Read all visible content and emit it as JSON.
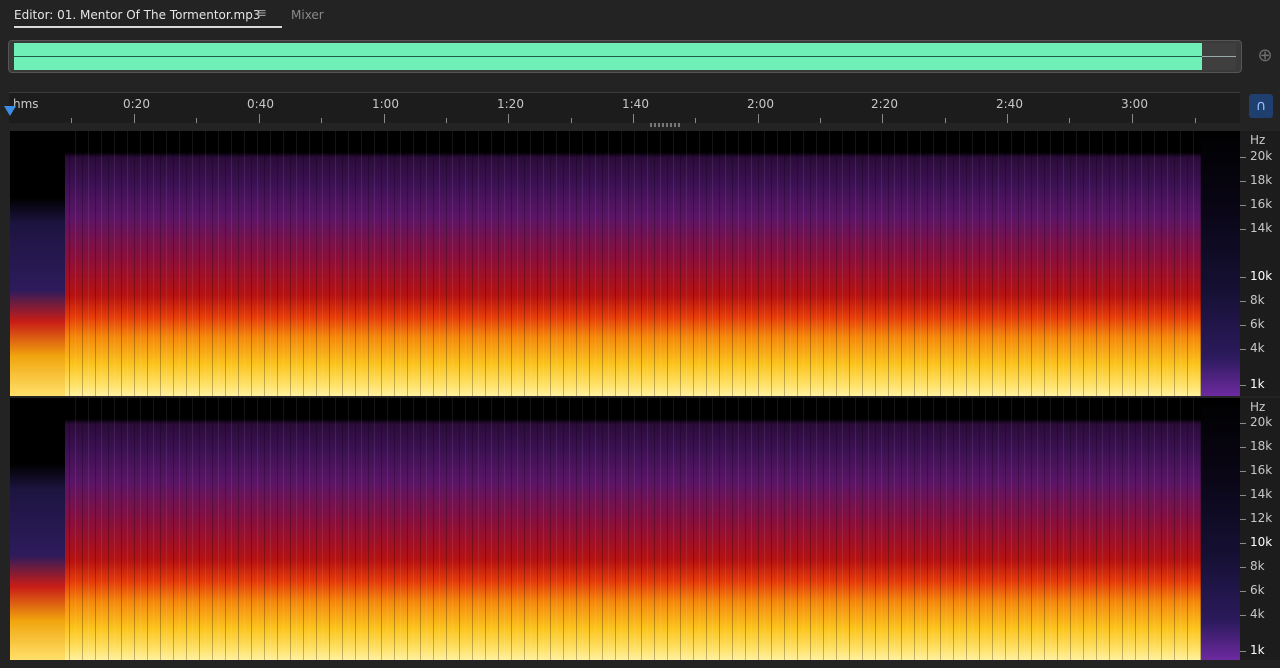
{
  "tabs": {
    "editor_label": "Editor: 01. Mentor Of The Tormentor.mp3",
    "mixer_label": "Mixer"
  },
  "ruler": {
    "labels": [
      "hms",
      "0:20",
      "0:40",
      "1:00",
      "1:20",
      "1:40",
      "2:00",
      "2:20",
      "2:40",
      "3:00"
    ]
  },
  "spectral": {
    "channel_top_labels": [
      "Hz",
      "20k",
      "18k",
      "16k",
      "14k",
      "10k",
      "8k",
      "6k",
      "4k",
      "1k"
    ],
    "channel_bottom_labels": [
      "Hz",
      "20k",
      "18k",
      "16k",
      "14k",
      "12k",
      "10k",
      "8k",
      "6k",
      "4k",
      "1k"
    ]
  },
  "icons": {
    "zoom": "zoom-icon",
    "snap": "magnet-icon",
    "menu": "hamburger-menu-icon"
  },
  "colors": {
    "overview_waveform": "#6ff0b6",
    "playhead": "#3c8de6"
  }
}
